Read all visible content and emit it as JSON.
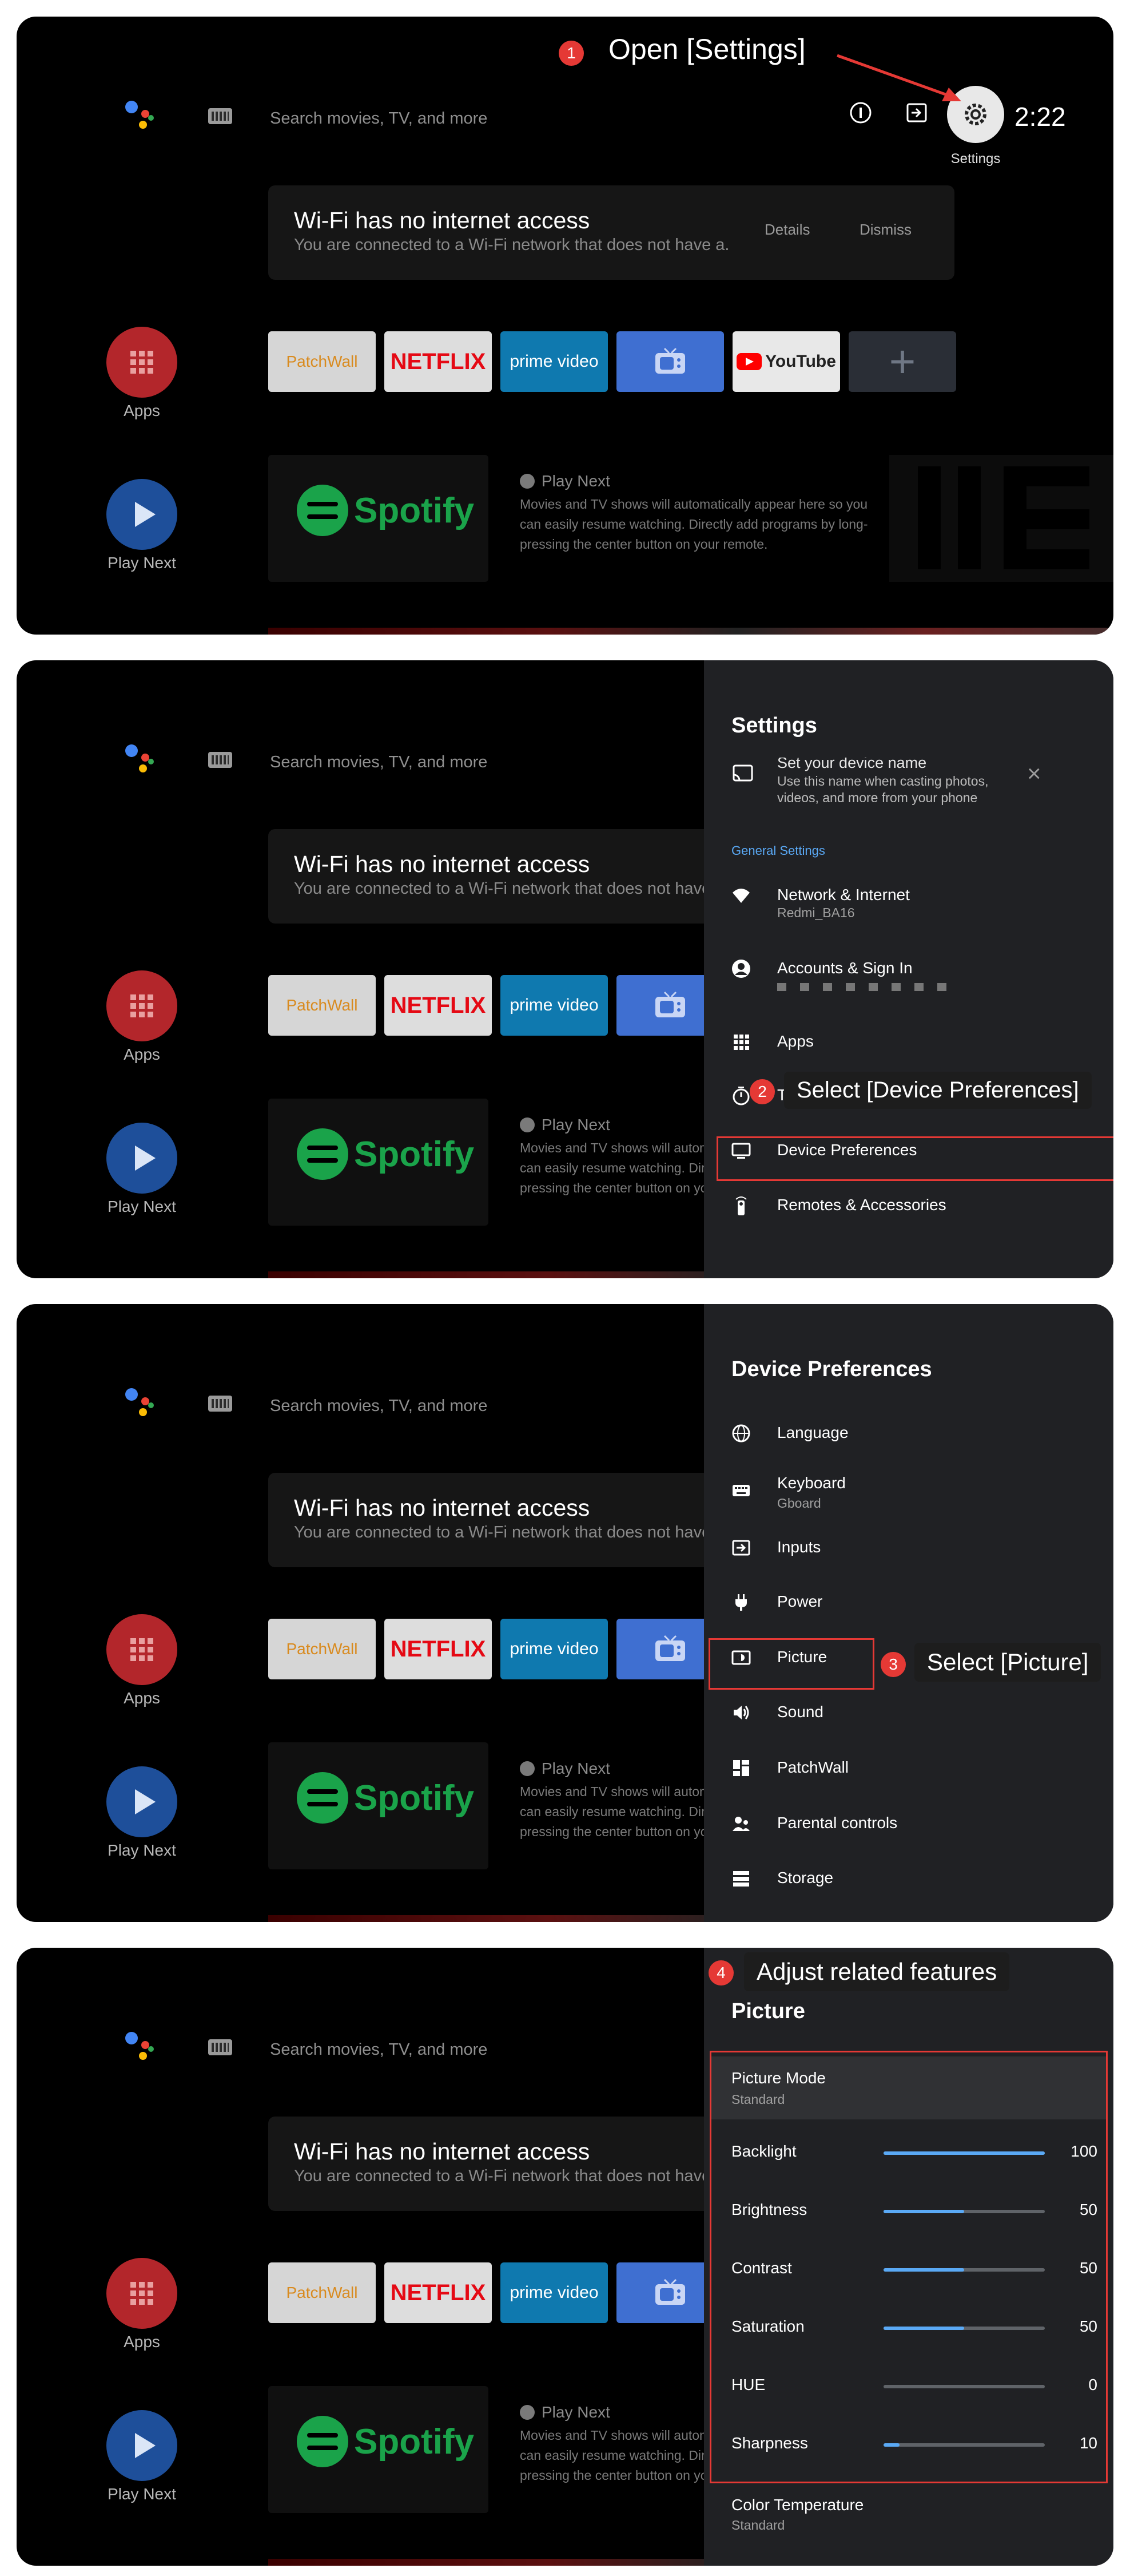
{
  "home": {
    "search_placeholder": "Search movies, TV, and more",
    "time": "2:22",
    "settings_label": "Settings",
    "wifi_title": "Wi-Fi has no internet access",
    "wifi_sub": "You are connected to a Wi-Fi network that does not have a..",
    "wifi_details": "Details",
    "wifi_dismiss": "Dismiss",
    "apps_label": "Apps",
    "play_next_label": "Play Next",
    "apps_row": [
      "PatchWall",
      "NETFLIX",
      "prime video",
      "TV",
      "YouTube",
      "+"
    ],
    "spotify": "Spotify",
    "pn_title": "Play Next",
    "pn_desc": "Movies and TV shows will automatically appear here so you can easily resume watching. Directly add programs by long-pressing the center button on your remote."
  },
  "steps": {
    "s1_num": "1",
    "s1": "Open [Settings]",
    "s2_num": "2",
    "s2": "Select [Device Preferences]",
    "s3_num": "3",
    "s3": "Select [Picture]",
    "s4_num": "4",
    "s4": "Adjust related features"
  },
  "settings": {
    "title": "Settings",
    "device_name": "Set your device name",
    "device_name_desc1": "Use this name when casting photos,",
    "device_name_desc2": "videos, and more from your phone",
    "section": "General Settings",
    "network": "Network & Internet",
    "network_sub": "Redmi_BA16",
    "accounts": "Accounts & Sign In",
    "apps": "Apps",
    "timer": "Timer",
    "device_prefs": "Device Preferences",
    "remotes": "Remotes & Accessories"
  },
  "prefs": {
    "title": "Device Preferences",
    "items": [
      {
        "icon": "globe-icon",
        "label": "Language",
        "sub": ""
      },
      {
        "icon": "keyboard-icon",
        "label": "Keyboard",
        "sub": "Gboard"
      },
      {
        "icon": "inputs-icon",
        "label": "Inputs",
        "sub": ""
      },
      {
        "icon": "plug-icon",
        "label": "Power",
        "sub": ""
      },
      {
        "icon": "picture-icon",
        "label": "Picture",
        "sub": ""
      },
      {
        "icon": "speaker-icon",
        "label": "Sound",
        "sub": ""
      },
      {
        "icon": "patchwall-icon",
        "label": "PatchWall",
        "sub": ""
      },
      {
        "icon": "parental-icon",
        "label": "Parental controls",
        "sub": ""
      },
      {
        "icon": "storage-icon",
        "label": "Storage",
        "sub": ""
      }
    ]
  },
  "picture": {
    "title": "Picture",
    "mode_label": "Picture Mode",
    "mode_value": "Standard",
    "sliders": [
      {
        "label": "Backlight",
        "value": 100
      },
      {
        "label": "Brightness",
        "value": 50
      },
      {
        "label": "Contrast",
        "value": 50
      },
      {
        "label": "Saturation",
        "value": 50
      },
      {
        "label": "HUE",
        "value": 0
      },
      {
        "label": "Sharpness",
        "value": 10
      }
    ],
    "color_temp_label": "Color Temperature",
    "color_temp_value": "Standard"
  },
  "colors": {
    "accent": "#5aa9f5",
    "highlight": "#e53935",
    "panel": "#202124"
  }
}
